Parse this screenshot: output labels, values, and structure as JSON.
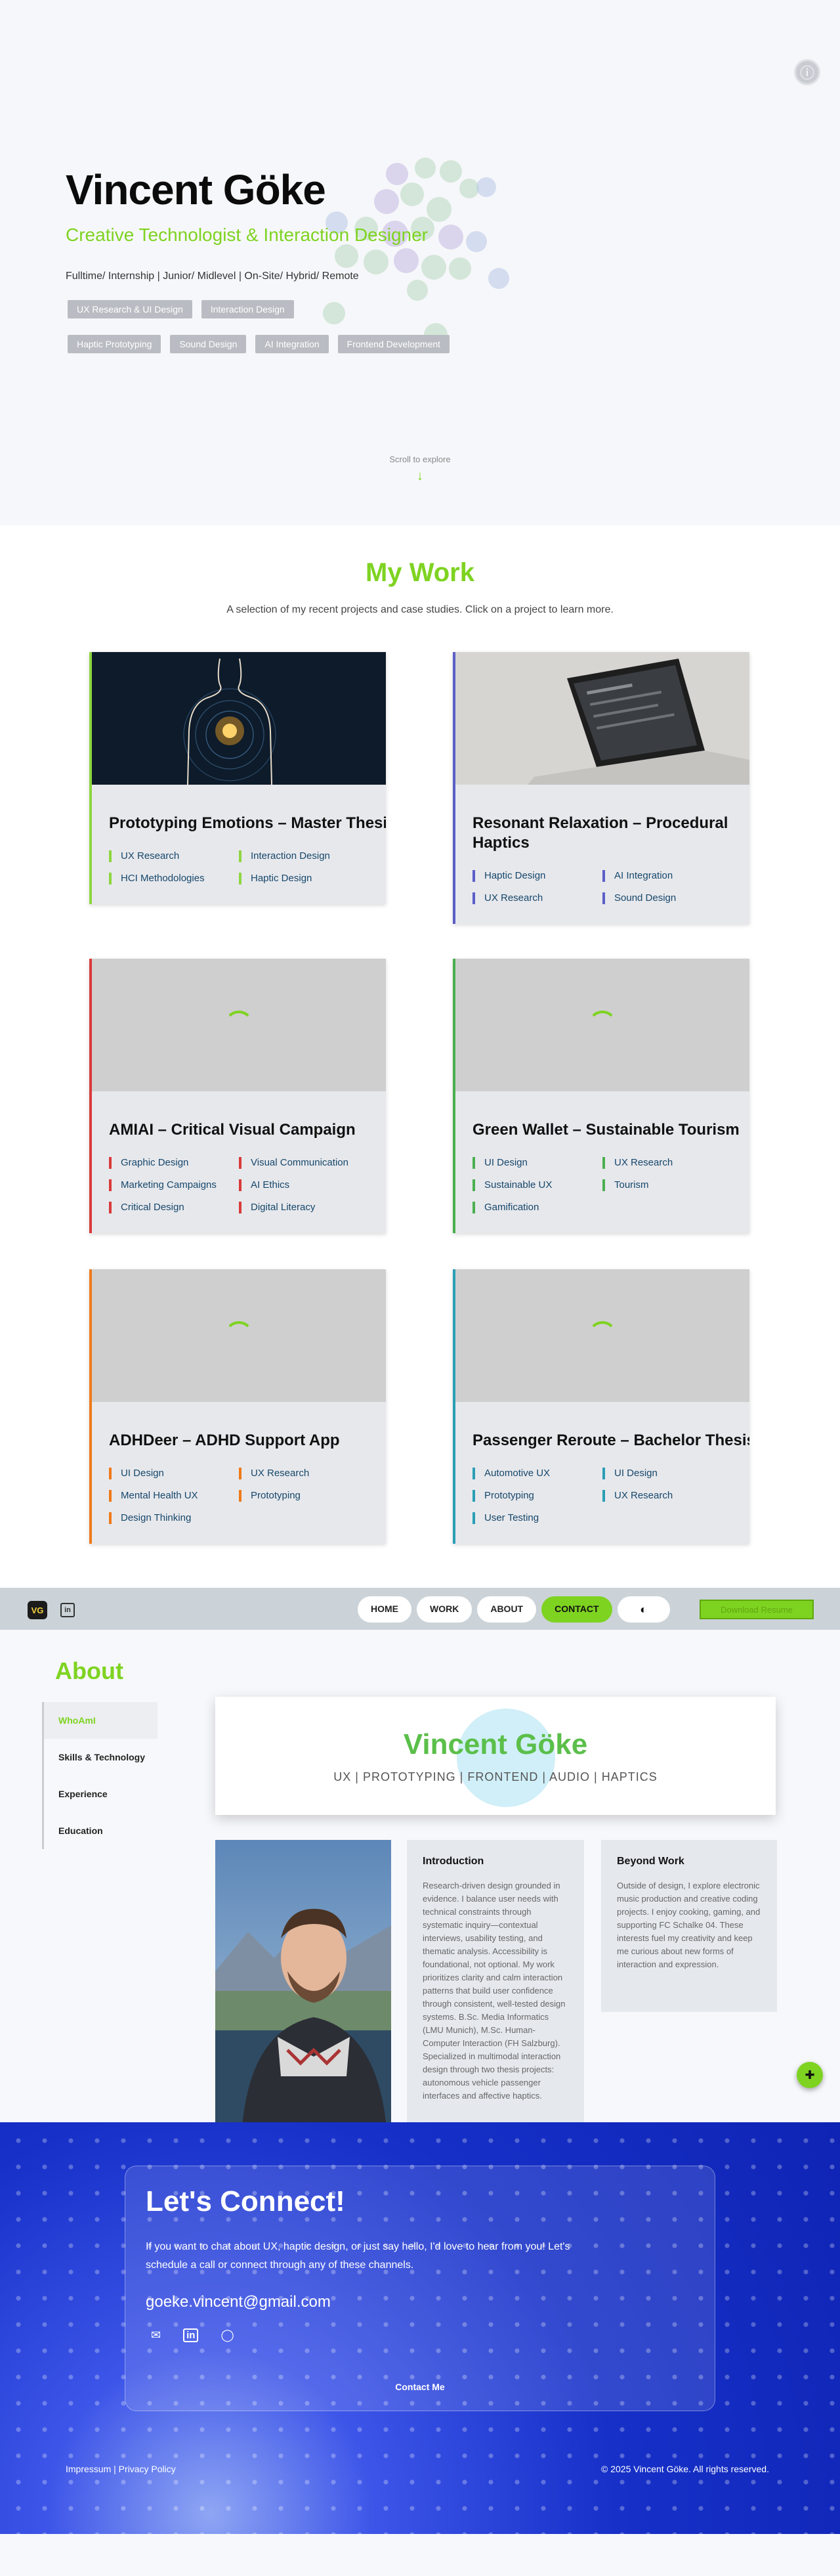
{
  "hero": {
    "name": "Vincent Göke",
    "subtitle": "Creative Technologist & Interaction Designer",
    "availability": "Fulltime/ Internship | Junior/ Midlevel | On-Site/ Hybrid/ Remote",
    "chips_row1": [
      "UX Research & UI Design",
      "Interaction Design"
    ],
    "chips_row2": [
      "Haptic Prototyping",
      "Sound Design",
      "AI Integration",
      "Frontend Development"
    ],
    "scroll_hint": "Scroll to explore",
    "scroll_arrow": "↓",
    "info_icon": "ⓘ"
  },
  "work": {
    "title": "My Work",
    "description": "A selection of my recent projects and case studies. Click on a project to learn more.",
    "projects": [
      {
        "title": "Prototyping Emotions – Master Thesis",
        "accent": "#8ed63f",
        "tags": [
          "UX Research",
          "Interaction Design",
          "HCI Methodologies",
          "Haptic Design"
        ]
      },
      {
        "title": "Resonant Relaxation – Procedural Haptics",
        "accent": "#5b5fc7",
        "tags": [
          "Haptic Design",
          "AI Integration",
          "UX Research",
          "Sound Design"
        ]
      },
      {
        "title": "AMIAI – Critical Visual Campaign",
        "accent": "#d93a3a",
        "tags": [
          "Graphic Design",
          "Visual Communication",
          "Marketing Campaigns",
          "AI Ethics",
          "Critical Design",
          "Digital Literacy"
        ]
      },
      {
        "title": "Green Wallet – Sustainable Tourism",
        "accent": "#4caf50",
        "tags": [
          "UI Design",
          "UX Research",
          "Sustainable UX",
          "Tourism",
          "Gamification"
        ]
      },
      {
        "title": "ADHDeer – ADHD Support App",
        "accent": "#ef7a1a",
        "tags": [
          "UI Design",
          "UX Research",
          "Mental Health UX",
          "Prototyping",
          "Design Thinking"
        ]
      },
      {
        "title": "Passenger Reroute – Bachelor Thesis",
        "accent": "#2a9fb5",
        "tags": [
          "Automotive UX",
          "UI Design",
          "Prototyping",
          "UX Research",
          "User Testing"
        ]
      }
    ]
  },
  "nav": {
    "logo": "VG",
    "linkedin": "in",
    "links": [
      "HOME",
      "WORK",
      "ABOUT",
      "CONTACT"
    ],
    "active": "CONTACT",
    "theme_icon": "◐",
    "cta": "Download Resume"
  },
  "about": {
    "title": "About",
    "menu": [
      "WhoAmI",
      "Skills & Technology",
      "Experience",
      "Education"
    ],
    "active_menu": "WhoAmI",
    "name": "Vincent Göke",
    "roles": "UX | PROTOTYPING | FRONTEND | AUDIO | HAPTICS",
    "intro_title": "Introduction",
    "intro_text": "Research-driven design grounded in evidence. I balance user needs with technical constraints through systematic inquiry—contextual interviews, usability testing, and thematic analysis. Accessibility is foundational, not optional. My work prioritizes clarity and calm interaction patterns that build user confidence through consistent, well-tested design systems. B.Sc. Media Informatics (LMU Munich), M.Sc. Human-Computer Interaction (FH Salzburg). Specialized in multimodal interaction design through two thesis projects: autonomous vehicle passenger interfaces and affective haptics.",
    "beyond_title": "Beyond Work",
    "beyond_text": "Outside of design, I explore electronic music production and creative coding projects. I enjoy cooking, gaming, and supporting FC Schalke 04. These interests fuel my creativity and keep me curious about new forms of interaction and expression.",
    "fab_icon": "✚"
  },
  "connect": {
    "title": "Let's Connect!",
    "text": "If you want to chat about UX, haptic design, or just say hello, I'd love to hear from you! Let's schedule a call or connect through any of these channels.",
    "email": "goeke.vincent@gmail.com",
    "icons": [
      "✉",
      "in",
      "◯"
    ],
    "cta": "Contact Me",
    "footer_left": "Impressum | Privacy Policy",
    "footer_right": "© 2025 Vincent Göke. All rights reserved."
  }
}
